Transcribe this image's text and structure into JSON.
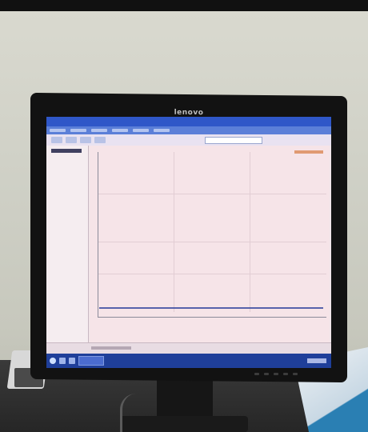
{
  "photo": {
    "monitor": {
      "brand": "lenovo"
    }
  }
}
